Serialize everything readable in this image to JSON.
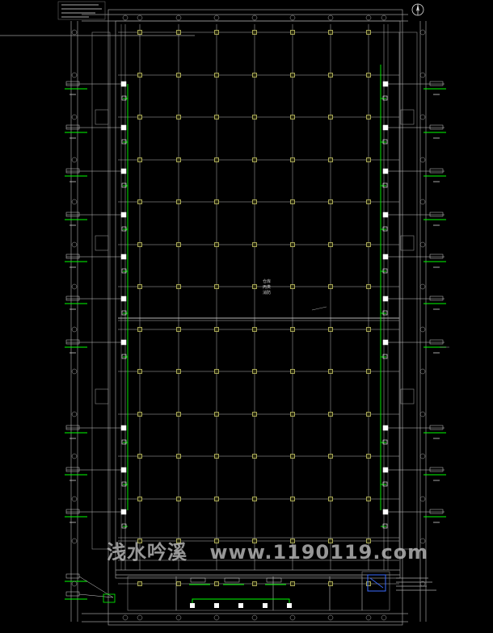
{
  "drawing": {
    "hall_label_lines": [
      "仓库",
      "丙类",
      "消防"
    ],
    "north_symbol": "north-arrow-icon",
    "colors": {
      "background": "#000000",
      "grid_line": "#b9b9b9",
      "column": "#c8c864",
      "wire": "#00ff00",
      "text": "#dcdcdc"
    }
  },
  "watermark": {
    "cn": "浅水吟溪",
    "url": "www.1190119.com"
  }
}
